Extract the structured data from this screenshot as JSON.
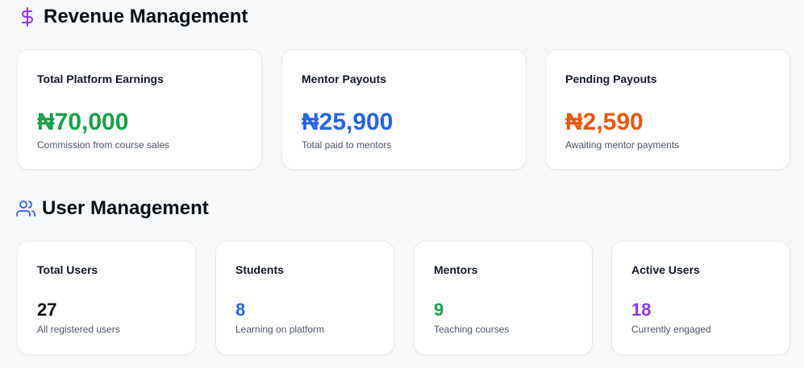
{
  "revenue": {
    "title": "Revenue Management",
    "cards": [
      {
        "label": "Total Platform Earnings",
        "value": "₦70,000",
        "sub": "Commission from course sales",
        "color": "#16a34a"
      },
      {
        "label": "Mentor Payouts",
        "value": "₦25,900",
        "sub": "Total paid to mentors",
        "color": "#2563eb"
      },
      {
        "label": "Pending Payouts",
        "value": "₦2,590",
        "sub": "Awaiting mentor payments",
        "color": "#ea580c"
      }
    ]
  },
  "users": {
    "title": "User Management",
    "cards": [
      {
        "label": "Total Users",
        "value": "27",
        "sub": "All registered users",
        "color": "#0b0f19"
      },
      {
        "label": "Students",
        "value": "8",
        "sub": "Learning on platform",
        "color": "#2563eb"
      },
      {
        "label": "Mentors",
        "value": "9",
        "sub": "Teaching courses",
        "color": "#16a34a"
      },
      {
        "label": "Active Users",
        "value": "18",
        "sub": "Currently engaged",
        "color": "#9333ea"
      }
    ]
  },
  "icons": {
    "revenue": "dollar-sign-icon",
    "users": "users-icon"
  },
  "colors": {
    "revenue_icon": "#9333ea",
    "users_icon": "#2563eb"
  }
}
